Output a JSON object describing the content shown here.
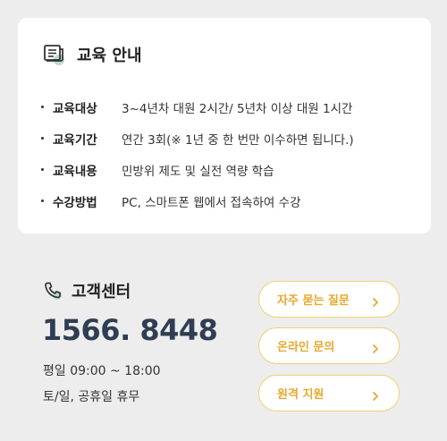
{
  "education": {
    "title": "교육 안내",
    "icon": "book-icon",
    "rows": [
      {
        "key": "교육대상",
        "value": "3~4년차 대원 2시간/ 5년차 이상 대원 1시간"
      },
      {
        "key": "교육기간",
        "value": "연간 3회(※ 1년 중 한 번만 이수하면 됩니다.)"
      },
      {
        "key": "교육내용",
        "value": "민방위 제도 및 실전 역량 학습"
      },
      {
        "key": "수강방법",
        "value": "PC, 스마트폰 웹에서 접속하여 수강"
      }
    ]
  },
  "support": {
    "title": "고객센터",
    "icon": "phone-icon",
    "phone": "1566. 8448",
    "hours": "평일 09:00 ~ 18:00",
    "closed": "토/일, 공휴일 휴무",
    "buttons": [
      {
        "label": "자주 묻는 질문"
      },
      {
        "label": "온라인 문의"
      },
      {
        "label": "원격 지원"
      }
    ]
  },
  "colors": {
    "accent": "#e8a82d",
    "accent_border": "#f3cf73",
    "phone_text": "#2f3e54",
    "background": "#ededed",
    "icon_green": "#b9dcc9"
  }
}
